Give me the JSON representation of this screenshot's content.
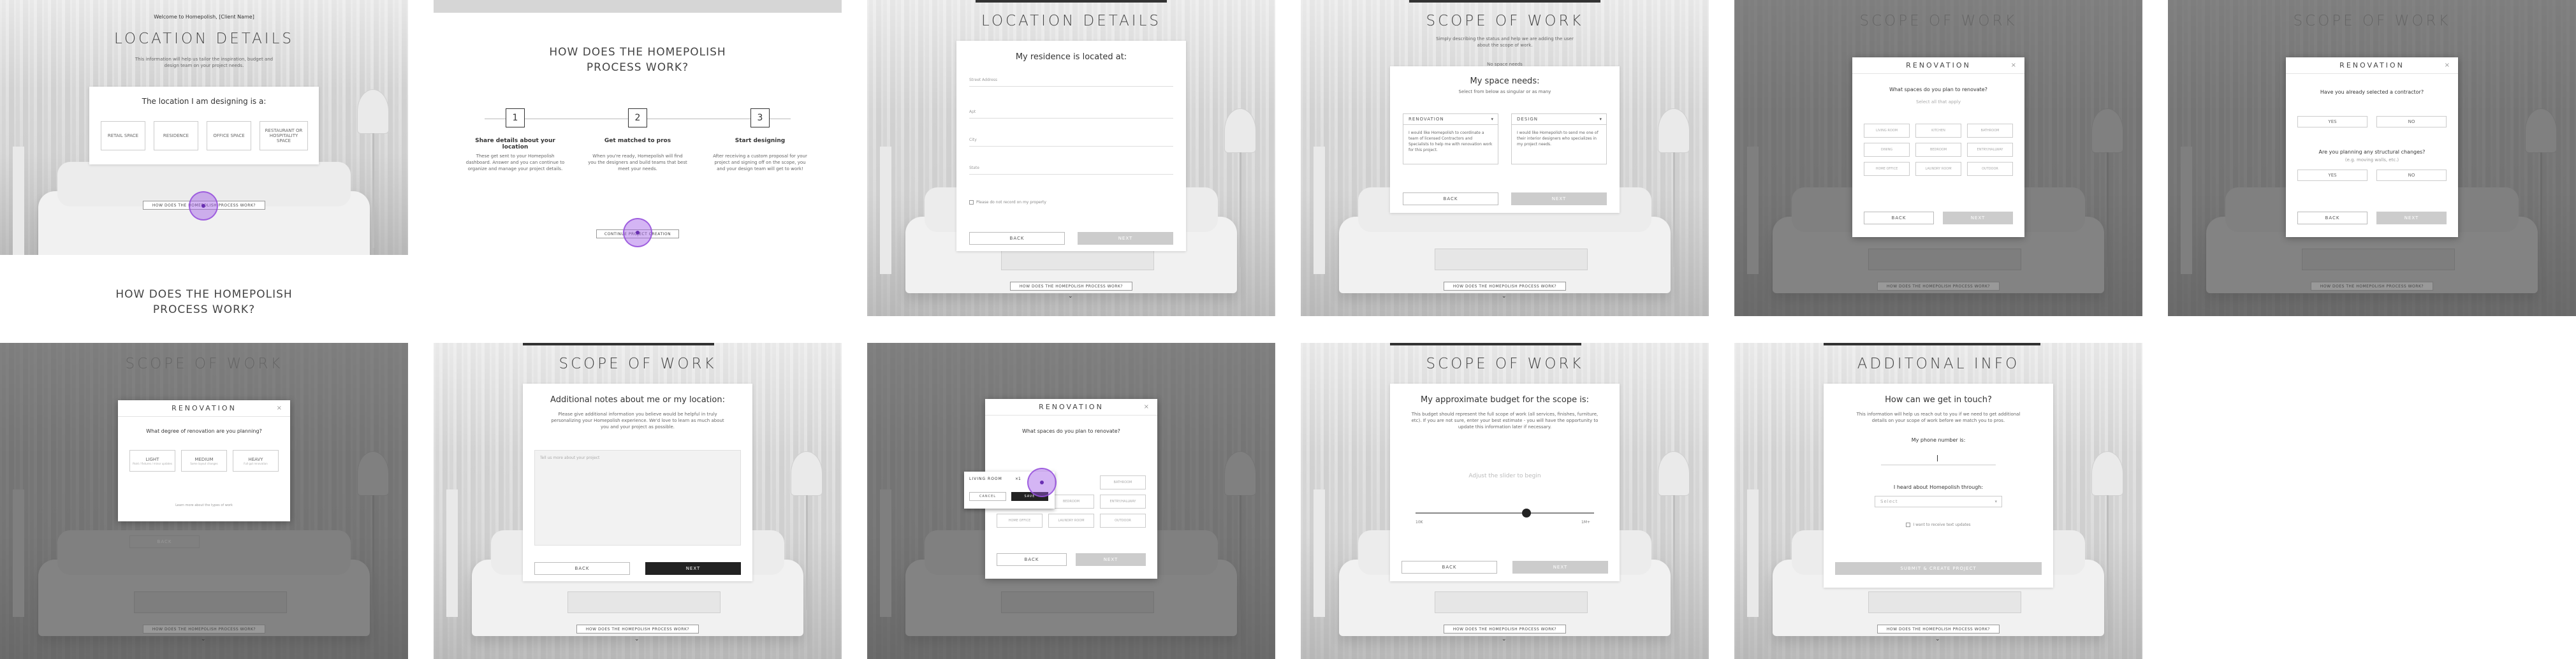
{
  "p1": {
    "welcome": "Welcome to Homepolish, [Client Name]",
    "title": "LOCATION DETAILS",
    "desc": "This information will help us tailor the inspiration, budget and design team on your project needs.",
    "card_title": "The location I am designing is a:",
    "options": [
      "RETAIL SPACE",
      "RESIDENCE",
      "OFFICE SPACE",
      "RESTAURANT OR HOSPITALITY SPACE"
    ],
    "link": "HOW DOES THE HOMEPOLISH PROCESS WORK?"
  },
  "p1b": {
    "heading_line1": "HOW DOES THE HOMEPOLISH",
    "heading_line2": "PROCESS WORK?"
  },
  "p2": {
    "heading_line1": "HOW DOES THE HOMEPOLISH",
    "heading_line2": "PROCESS WORK?",
    "steps": [
      {
        "num": "1",
        "title": "Share details about your location",
        "desc": "These get sent to your Homepolish dashboard. Answer and you can continue to organize and manage your project details."
      },
      {
        "num": "2",
        "title": "Get matched to pros",
        "desc": "When you're ready, Homepolish will find you the designers and build teams that best meet your needs."
      },
      {
        "num": "3",
        "title": "Start designing",
        "desc": "After receiving a custom proposal for your project and signing off on the scope, you and your design team will get to work!"
      }
    ],
    "continue": "CONTINUE PROJECT CREATION"
  },
  "p3": {
    "title": "LOCATION DETAILS",
    "card_title": "My residence is located at:",
    "fields": [
      "Street Address",
      "Apt",
      "City",
      "State"
    ],
    "checkbox": "Please do not record on my property",
    "back": "BACK",
    "next": "NEXT",
    "link": "HOW DOES THE HOMEPOLISH PROCESS WORK?"
  },
  "p4": {
    "title": "SCOPE OF WORK",
    "desc": "Simply describing the status and help we are adding the user about the scope of work.",
    "needs_text": "My space needs:",
    "subtitle": "Select from below as singular or as many",
    "col1": "RENOVATION",
    "col1_desc": "I would like Homepolish to coordinate a team of licensed Contractors and Specialists to help me with renovation work for this project.",
    "col2": "DESIGN",
    "col2_desc": "I would like Homepolish to send me one of their interior designers who specializes in my project needs.",
    "back": "BACK",
    "next": "NEXT",
    "link": "HOW DOES THE HOMEPOLISH PROCESS WORK?",
    "topline": "No space needs"
  },
  "p5": {
    "title": "SCOPE OF WORK",
    "modal": "RENOVATION",
    "close": "×",
    "question": "What spaces do you plan to renovate?",
    "subq": "Select all that apply",
    "options": [
      "LIVING ROOM",
      "KITCHEN",
      "BATHROOM",
      "DINING",
      "BEDROOM",
      "ENTRY/HALLWAY",
      "HOME OFFICE",
      "LAUNDRY ROOM",
      "OUTDOOR"
    ],
    "back": "BACK",
    "next": "NEXT",
    "link": "HOW DOES THE HOMEPOLISH PROCESS WORK?"
  },
  "p6": {
    "title": "SCOPE OF WORK",
    "modal": "RENOVATION",
    "close": "×",
    "q1": "Have you already selected a contractor?",
    "q2": "Are you planning any structural changes?",
    "q2_sub": "(e.g. moving walls, etc.)",
    "yes": "YES",
    "no": "NO",
    "back": "BACK",
    "next": "NEXT",
    "link": "HOW DOES THE HOMEPOLISH PROCESS WORK?"
  },
  "p7": {
    "title": "SCOPE OF WORK",
    "modal": "RENOVATION",
    "close": "×",
    "question": "What degree of renovation are you planning?",
    "options": [
      {
        "label": "LIGHT",
        "sub": "Paint / fixtures / minor updates"
      },
      {
        "label": "MEDIUM",
        "sub": "Some layout changes"
      },
      {
        "label": "HEAVY",
        "sub": "Full gut renovation"
      }
    ],
    "note": "Learn more about the types of work",
    "back": "BACK",
    "link": "HOW DOES THE HOMEPOLISH PROCESS WORK?"
  },
  "p8": {
    "title": "SCOPE OF WORK",
    "card_title": "Additional notes about me or my location:",
    "desc": "Please give additional information you believe would be helpful in truly personalizing your Homepolish experience. We'd love to learn as much about you and your project as possible.",
    "placeholder": "Tell us more about your project",
    "back": "BACK",
    "next": "NEXT",
    "link": "HOW DOES THE HOMEPOLISH PROCESS WORK?"
  },
  "p9": {
    "modal": "RENOVATION",
    "close": "×",
    "question": "What spaces do you plan to renovate?",
    "popup_label": "LIVING ROOM",
    "popup_qty": "×1",
    "popup_cancel": "CANCEL",
    "popup_save": "SAVE",
    "options": [
      "LIVING ROOM",
      "KITCHEN",
      "BATHROOM",
      "DINING",
      "BEDROOM",
      "ENTRY/HALLWAY",
      "HOME OFFICE",
      "LAUNDRY ROOM",
      "OUTDOOR"
    ],
    "back": "BACK",
    "next": "NEXT",
    "link": "HOW DOES THE HOMEPOLISH PROCESS WORK?"
  },
  "p10": {
    "title": "SCOPE OF WORK",
    "card_title": "My approximate budget for the scope is:",
    "desc": "This budget should represent the full scope of work (all services, finishes, furniture, etc). If you are not sure, enter your best estimate - you will have the opportunity to update this information later if necessary.",
    "slider_label": "Adjust the slider to begin",
    "min": "10K",
    "max": "1M+",
    "slider_value": 0.62,
    "back": "BACK",
    "next": "NEXT",
    "link": "HOW DOES THE HOMEPOLISH PROCESS WORK?"
  },
  "p11": {
    "title": "ADDITONAL INFO",
    "card_title": "How can we get in touch?",
    "desc": "This information will help us reach out to you if we need to get additional details on your scope of work before we match you to pros.",
    "phone_label": "My phone number is:",
    "heard": "I heard about Homepolish through:",
    "select": "Select",
    "checkbox": "I want to receive text updates",
    "submit": "SUBMIT & CREATE PROJECT",
    "link": "HOW DOES THE HOMEPOLISH PROCESS WORK?"
  }
}
